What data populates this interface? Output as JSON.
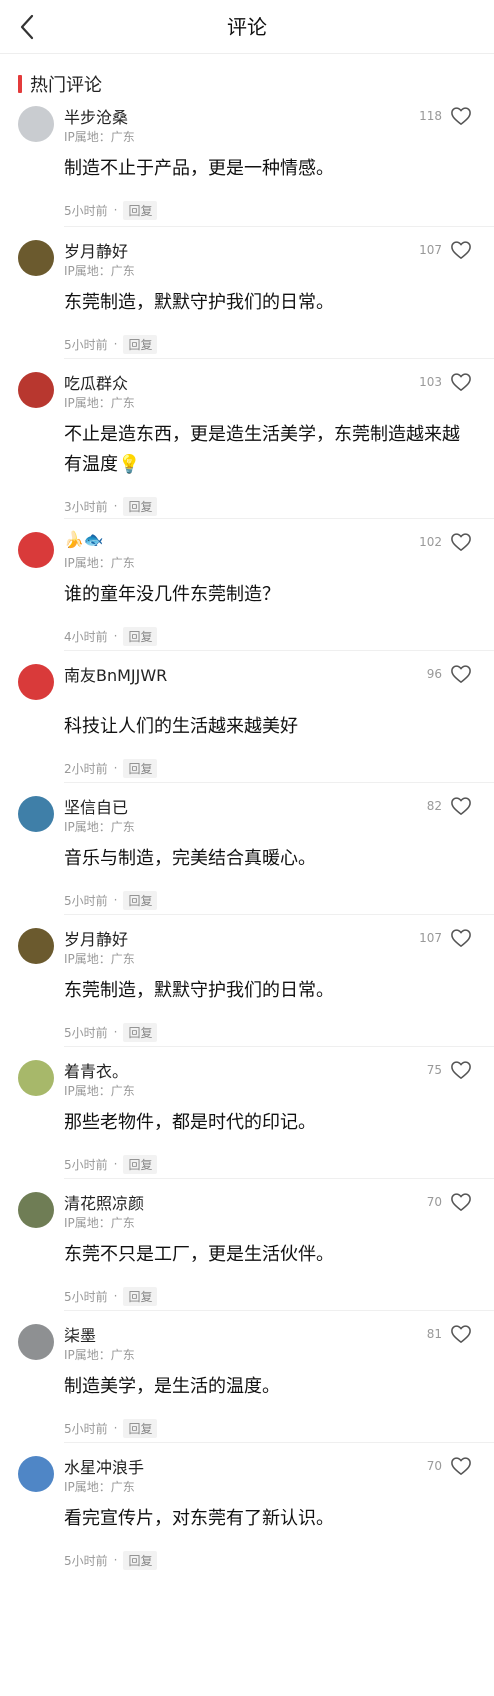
{
  "header": {
    "title": "评论"
  },
  "section": {
    "title": "热门评论"
  },
  "comments": [
    {
      "username": "半步沧桑",
      "ip": "IP属地：广东",
      "likes": "118",
      "content": "制造不止于产品，更是一种情感。",
      "time": "5小时前",
      "reply": "回复",
      "avatar_color": "#c9ccd0"
    },
    {
      "username": "岁月静好",
      "ip": "IP属地：广东",
      "likes": "107",
      "content": "东莞制造，默默守护我们的日常。",
      "time": "5小时前",
      "reply": "回复",
      "avatar_color": "#6b5a2e"
    },
    {
      "username": "吃瓜群众",
      "ip": "IP属地：广东",
      "likes": "103",
      "content": "不止是造东西，更是造生活美学，东莞制造越来越有温度💡",
      "time": "3小时前",
      "reply": "回复",
      "avatar_color": "#b8372f"
    },
    {
      "username": "🍌🐟",
      "ip": "IP属地：广东",
      "likes": "102",
      "content": "谁的童年没几件东莞制造？",
      "time": "4小时前",
      "reply": "回复",
      "avatar_color": "#d93a3a"
    },
    {
      "username": "南友BnMJJWR",
      "ip": "",
      "likes": "96",
      "content": "科技让人们的生活越来越美好",
      "time": "2小时前",
      "reply": "回复",
      "avatar_color": "#d93a3a"
    },
    {
      "username": "坚信自已",
      "ip": "IP属地：广东",
      "likes": "82",
      "content": "音乐与制造，完美结合真暖心。",
      "time": "5小时前",
      "reply": "回复",
      "avatar_color": "#3f7fa8"
    },
    {
      "username": "岁月静好",
      "ip": "IP属地：广东",
      "likes": "107",
      "content": "东莞制造，默默守护我们的日常。",
      "time": "5小时前",
      "reply": "回复",
      "avatar_color": "#6b5a2e"
    },
    {
      "username": "着青衣。",
      "ip": "IP属地：广东",
      "likes": "75",
      "content": "那些老物件，都是时代的印记。",
      "time": "5小时前",
      "reply": "回复",
      "avatar_color": "#a7b86a"
    },
    {
      "username": "清花照凉颜",
      "ip": "IP属地：广东",
      "likes": "70",
      "content": "东莞不只是工厂，更是生活伙伴。",
      "time": "5小时前",
      "reply": "回复",
      "avatar_color": "#6f7d55"
    },
    {
      "username": "柒墨",
      "ip": "IP属地：广东",
      "likes": "81",
      "content": "制造美学，是生活的温度。",
      "time": "5小时前",
      "reply": "回复",
      "avatar_color": "#8e9092"
    },
    {
      "username": "水星冲浪手",
      "ip": "IP属地：广东",
      "likes": "70",
      "content": "看完宣传片，对东莞有了新认识。",
      "time": "5小时前",
      "reply": "回复",
      "avatar_color": "#4f86c6"
    }
  ]
}
